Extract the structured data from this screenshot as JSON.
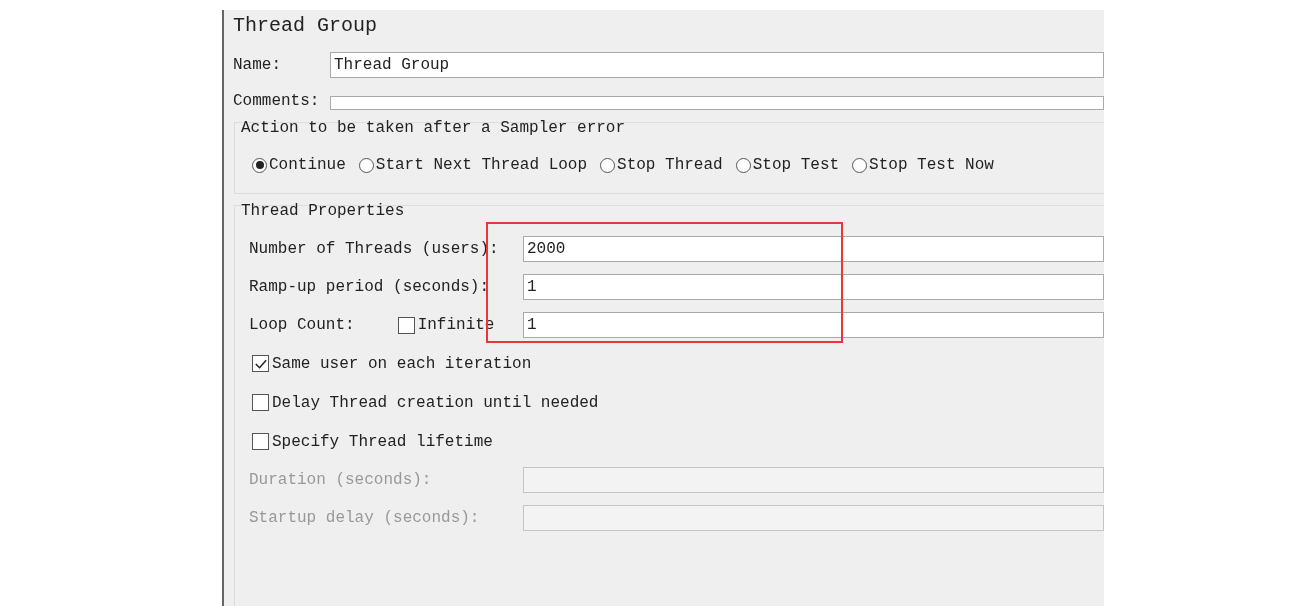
{
  "panel": {
    "title": "Thread Group"
  },
  "name_field": {
    "label": "Name:",
    "value": "Thread Group"
  },
  "comments_field": {
    "label": "Comments:"
  },
  "sampler_error": {
    "legend": "Action to be taken after a Sampler error",
    "options": [
      {
        "label": "Continue",
        "selected": true
      },
      {
        "label": "Start Next Thread Loop",
        "selected": false
      },
      {
        "label": "Stop Thread",
        "selected": false
      },
      {
        "label": "Stop Test",
        "selected": false
      },
      {
        "label": "Stop Test Now",
        "selected": false
      }
    ]
  },
  "thread_properties": {
    "legend": "Thread Properties",
    "rows": [
      {
        "kind": "field",
        "label": "Number of Threads (users):",
        "value": "2000",
        "disabled": false
      },
      {
        "kind": "field",
        "label": "Ramp-up period (seconds):",
        "value": "1",
        "disabled": false
      },
      {
        "kind": "loop",
        "label": "Loop Count:",
        "checkbox_label": "Infinite",
        "checked": false,
        "value": "1",
        "disabled": false
      },
      {
        "kind": "checkbox",
        "label": "Same user on each iteration",
        "checked": true
      },
      {
        "kind": "checkbox",
        "label": "Delay Thread creation until needed",
        "checked": false
      },
      {
        "kind": "checkbox",
        "label": "Specify Thread lifetime",
        "checked": false
      },
      {
        "kind": "field",
        "label": "Duration (seconds):",
        "value": "",
        "disabled": true
      },
      {
        "kind": "field",
        "label": "Startup delay (seconds):",
        "value": "",
        "disabled": true
      }
    ]
  },
  "highlight_box": true
}
